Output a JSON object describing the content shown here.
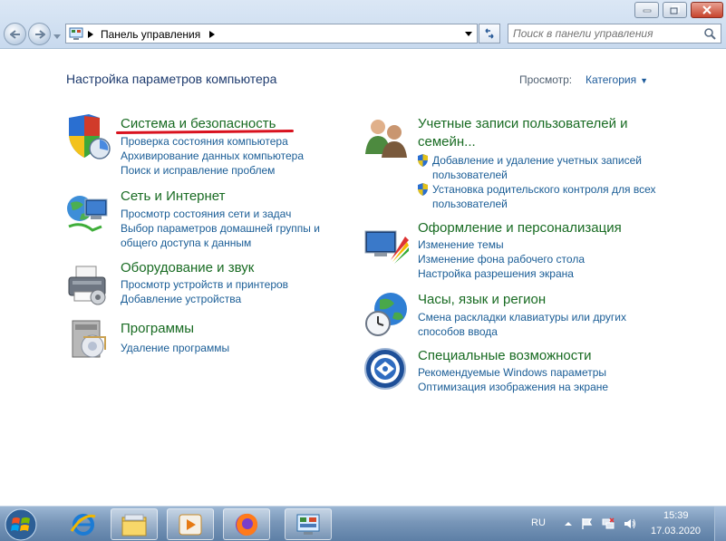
{
  "window": {
    "address": "Панель управления",
    "search_placeholder": "Поиск в панели управления"
  },
  "header": {
    "title": "Настройка параметров компьютера",
    "view_label": "Просмотр:",
    "view_value": "Категория"
  },
  "categories": [
    {
      "title": "Система и безопасность",
      "links": [
        "Проверка состояния компьютера",
        "Архивирование данных компьютера",
        "Поиск и исправление проблем"
      ]
    },
    {
      "title": "Сеть и Интернет",
      "links": [
        "Просмотр состояния сети и задач",
        "Выбор параметров домашней группы и",
        "общего доступа к данным"
      ]
    },
    {
      "title": "Оборудование и звук",
      "links": [
        "Просмотр устройств и принтеров",
        "Добавление устройства"
      ]
    },
    {
      "title": "Программы",
      "links": [
        "Удаление программы"
      ]
    },
    {
      "title": "Учетные записи пользователей и",
      "title2": "семейн...",
      "links": [
        "Добавление и удаление учетных записей",
        "пользователей",
        "Установка родительского контроля для всех",
        "пользователей"
      ]
    },
    {
      "title": "Оформление и персонализация",
      "links": [
        "Изменение темы",
        "Изменение фона рабочего стола",
        "Настройка разрешения экрана"
      ]
    },
    {
      "title": "Часы, язык и регион",
      "links": [
        "Смена раскладки клавиатуры или других",
        "способов ввода"
      ]
    },
    {
      "title": "Специальные возможности",
      "links": [
        "Рекомендуемые Windows параметры",
        "Оптимизация изображения на экране"
      ]
    }
  ],
  "taskbar": {
    "language": "RU",
    "time": "15:39",
    "date": "17.03.2020"
  },
  "colors": {
    "category_title": "#186b22",
    "link": "#1a5d96",
    "highlight_underline": "#d9121e"
  }
}
